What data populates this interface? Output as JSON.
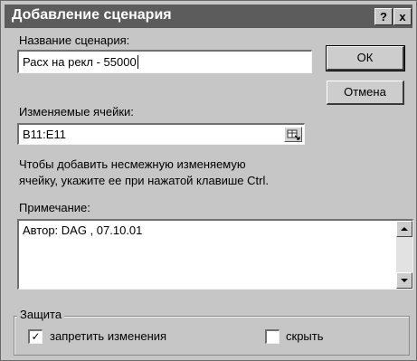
{
  "dialog": {
    "title": "Добавление сценария",
    "help_label": "?",
    "close_label": "x"
  },
  "scenario_name": {
    "label": "Название сценария:",
    "value": "Расх на рекл - 55000"
  },
  "changing_cells": {
    "label": "Изменяемые ячейки:",
    "value": "B11:E11",
    "hint_line1": "Чтобы добавить несмежную изменяемую",
    "hint_line2": "ячейку, укажите ее при нажатой клавише Ctrl."
  },
  "comment": {
    "label": "Примечание:",
    "value": "Автор: DAG , 07.10.01"
  },
  "buttons": {
    "ok": "ОК",
    "cancel": "Отмена"
  },
  "protection": {
    "legend": "Защита",
    "prevent_changes": {
      "label": "запретить изменения",
      "checked": true
    },
    "hide": {
      "label": "скрыть",
      "checked": false
    }
  }
}
